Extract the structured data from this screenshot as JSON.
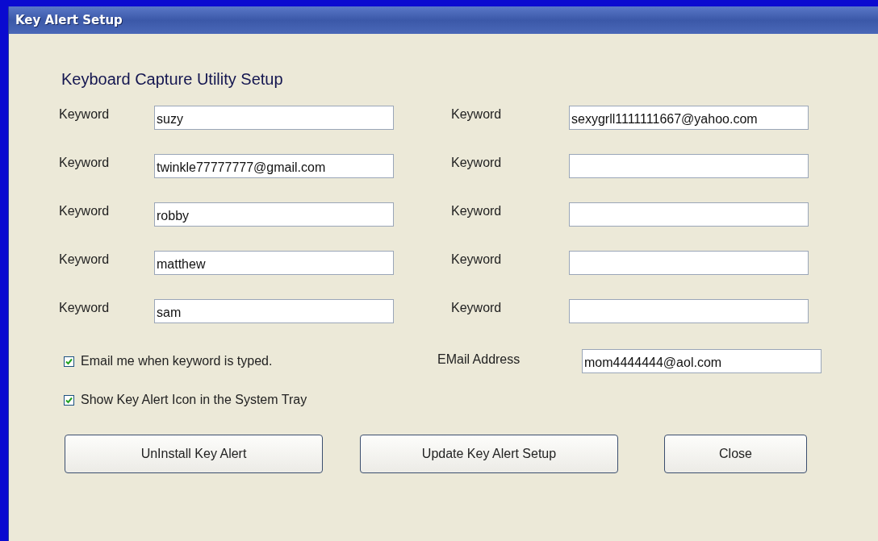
{
  "window": {
    "title": "Key Alert Setup"
  },
  "heading": "Keyboard Capture Utility Setup",
  "keyword_rows": [
    {
      "left": {
        "label": "Keyword",
        "value": "suzy"
      },
      "right": {
        "label": "Keyword",
        "value": "sexygrll1111111667@yahoo.com"
      }
    },
    {
      "left": {
        "label": "Keyword",
        "value": "twinkle77777777@gmail.com"
      },
      "right": {
        "label": "Keyword"
      }
    },
    {
      "left": {
        "label": "Keyword",
        "value": "robby"
      },
      "right": {
        "label": "Keyword"
      }
    },
    {
      "left": {
        "label": "Keyword",
        "value": "matthew"
      },
      "right": {
        "label": "Keyword"
      }
    },
    {
      "left": {
        "label": "Keyword",
        "value": "sam"
      },
      "right": {
        "label": "Keyword"
      }
    }
  ],
  "checkboxes": [
    {
      "label": "Email me when keyword is typed.",
      "checked": true
    },
    {
      "label": "Show Key Alert Icon in the System Tray",
      "checked": true
    }
  ],
  "email_field": {
    "label": "EMail Address",
    "value": "mom4444444@aol.com"
  },
  "buttons": [
    "UnInstall Key Alert",
    "Update Key Alert Setup",
    "Close"
  ]
}
